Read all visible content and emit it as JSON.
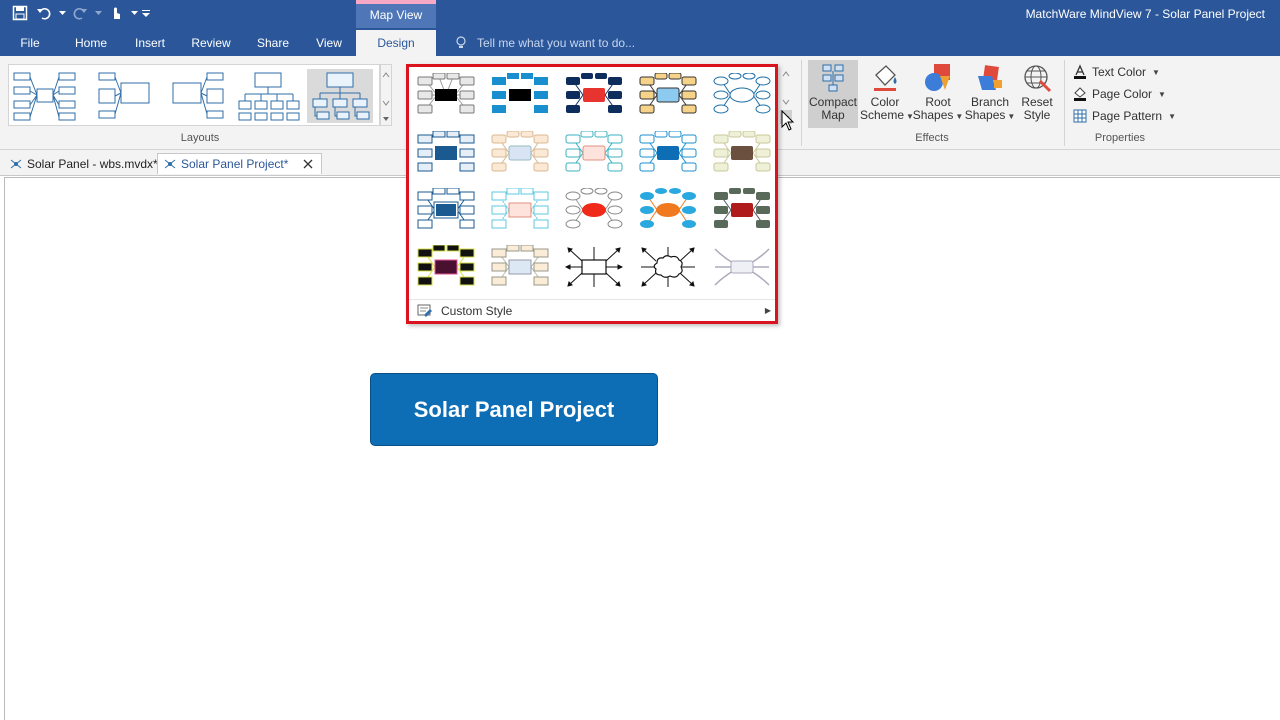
{
  "app_title": "MatchWare MindView 7 - Solar Panel Project",
  "context_tab": "Map View",
  "tabs": [
    {
      "label": "File",
      "active": false
    },
    {
      "label": "Home",
      "active": false
    },
    {
      "label": "Insert",
      "active": false
    },
    {
      "label": "Review",
      "active": false
    },
    {
      "label": "Share",
      "active": false
    },
    {
      "label": "View",
      "active": false
    },
    {
      "label": "Design",
      "active": true
    }
  ],
  "tell_me_placeholder": "Tell me what you want to do...",
  "ribbon": {
    "layouts_label": "Layouts",
    "effects_label": "Effects",
    "properties_label": "Properties",
    "compact_map": {
      "line1": "Compact",
      "line2": "Map"
    },
    "color_scheme": {
      "line1": "Color",
      "line2": "Scheme"
    },
    "root_shapes": {
      "line1": "Root",
      "line2": "Shapes"
    },
    "branch_shapes": {
      "line1": "Branch",
      "line2": "Shapes"
    },
    "reset_style": {
      "line1": "Reset",
      "line2": "Style"
    },
    "text_color": "Text Color",
    "page_color": "Page Color",
    "page_pattern": "Page Pattern"
  },
  "doc_tabs": [
    {
      "label": "Solar Panel - wbs.mvdx*",
      "active": false
    },
    {
      "label": "Solar Panel Project*",
      "active": true
    }
  ],
  "root_node_text": "Solar Panel Project",
  "styles_menu": {
    "custom_style_label": "Custom Style"
  },
  "colors": {
    "title_bar": "#2b579a",
    "root_node": "#0d6eb6",
    "highlight_border": "#d9141e"
  }
}
